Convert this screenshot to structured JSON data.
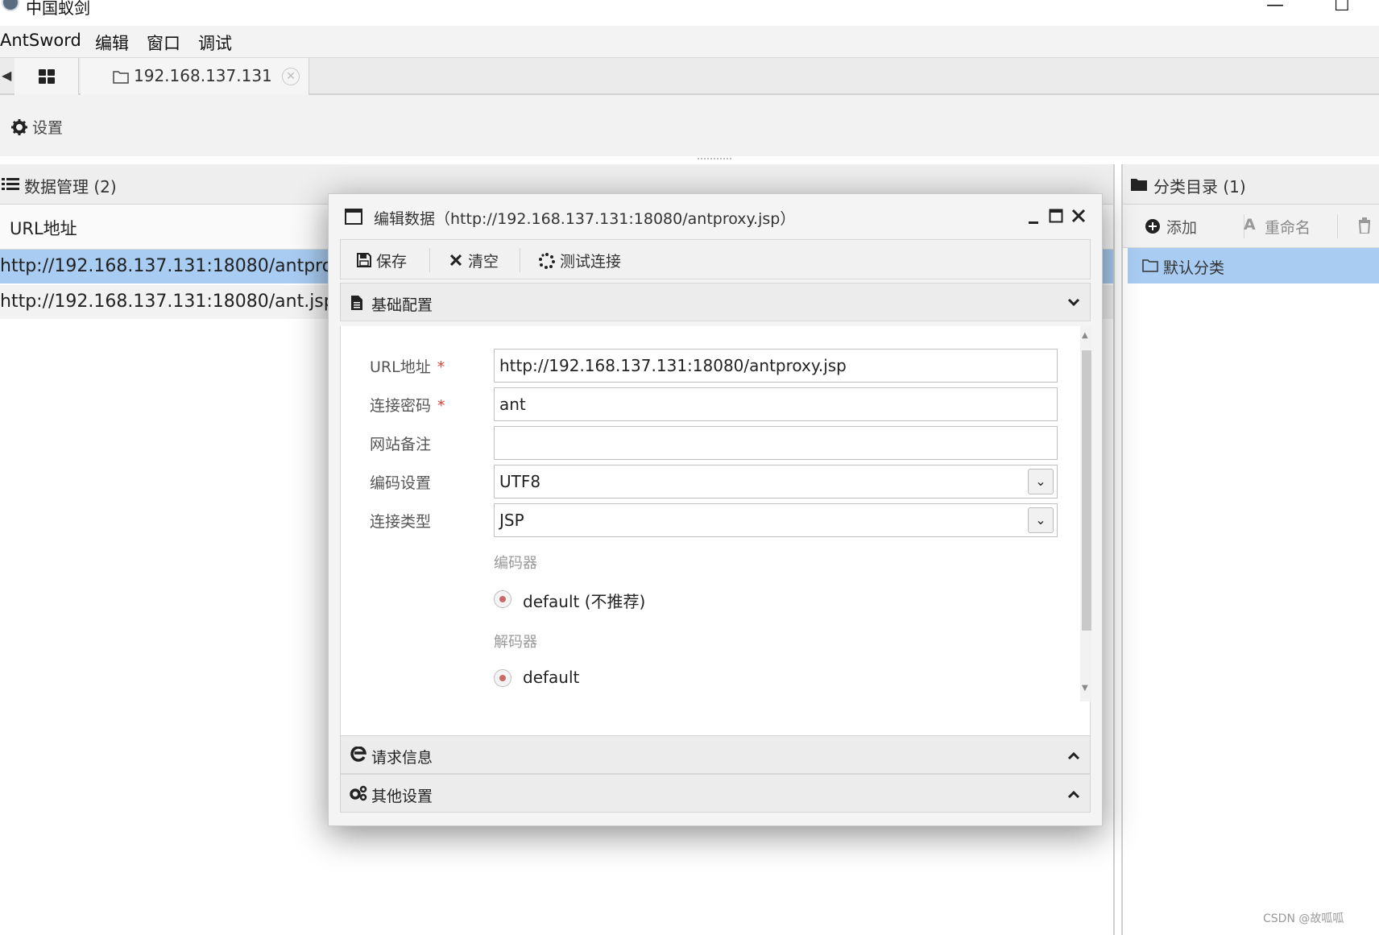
{
  "window": {
    "title": "中国蚁剑",
    "minimize_glyph": "—",
    "maximize_glyph": "☐"
  },
  "menubar": {
    "items": [
      "AntSword",
      "编辑",
      "窗口",
      "调试"
    ]
  },
  "tabs": {
    "host_tab_label": "192.168.137.131",
    "close_glyph": "✕"
  },
  "settings": {
    "label": "设置"
  },
  "data_panel": {
    "title": "数据管理 (2)",
    "column_header": "URL地址",
    "rows": [
      {
        "url": "http://192.168.137.131:18080/antproxy.jsp",
        "selected": true
      },
      {
        "url": "http://192.168.137.131:18080/ant.jsp",
        "selected": false
      }
    ]
  },
  "category_panel": {
    "title": "分类目录 (1)",
    "add_label": "添加",
    "rename_label": "重命名",
    "rename_glyph": "A",
    "category": "默认分类"
  },
  "dialog": {
    "title": "编辑数据（http://192.168.137.131:18080/antproxy.jsp）",
    "toolbar": {
      "save_label": "保存",
      "clear_label": "清空",
      "test_label": "测试连接"
    },
    "sections": {
      "basic": "基础配置",
      "request": "请求信息",
      "other": "其他设置"
    },
    "form": {
      "url_label": "URL地址",
      "url_value": "http://192.168.137.131:18080/antproxy.jsp",
      "password_label": "连接密码",
      "password_value": "ant",
      "note_label": "网站备注",
      "note_value": "",
      "encoding_label": "编码设置",
      "encoding_value": "UTF8",
      "type_label": "连接类型",
      "type_value": "JSP",
      "encoder_heading": "编码器",
      "encoder_option": "default (不推荐)",
      "decoder_heading": "解码器",
      "decoder_option": "default",
      "required_mark": "*"
    }
  },
  "watermark": "CSDN @故呱呱",
  "colors": {
    "selected_row": "#a8ccf2",
    "required_star": "#e0433b",
    "radio_dot": "#c96a6a"
  },
  "icons": {
    "grid": "grid-icon",
    "folder": "folder-icon",
    "gear": "gear-icon",
    "list": "list-icon",
    "plus": "plus-circle-icon",
    "trash": "trash-icon",
    "window": "window-icon",
    "save": "save-icon",
    "clear": "x-icon",
    "test": "spinner-icon",
    "doc": "document-icon",
    "browser": "browser-icon",
    "cogs": "cogs-icon"
  }
}
